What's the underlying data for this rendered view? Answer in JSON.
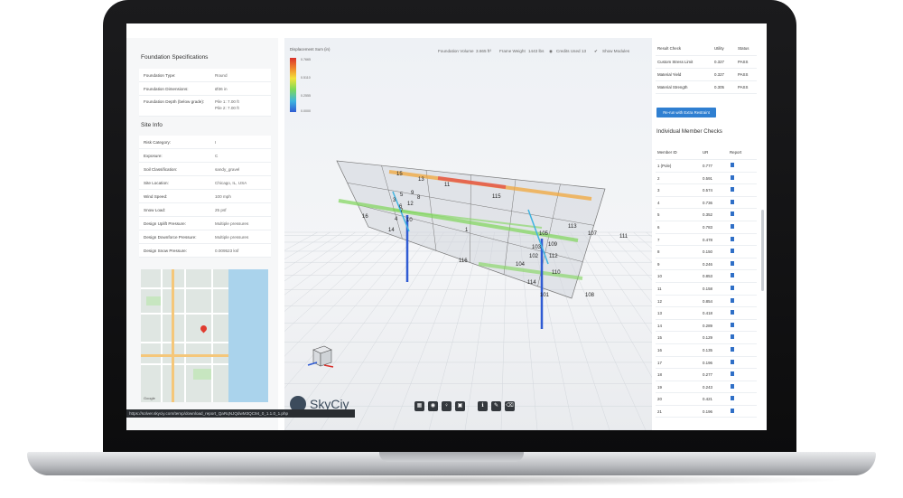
{
  "left_panel": {
    "foundation_title": "Foundation Specifications",
    "foundation": [
      {
        "k": "Foundation Type:",
        "v": "Round"
      },
      {
        "k": "Foundation Dimensions:",
        "v": "Ø36 in"
      },
      {
        "k": "Foundation Depth (below grade):",
        "v": "Pile 1: 7.00 ft",
        "v2": "Pile 2: 7.00 ft"
      }
    ],
    "site_title": "Site Info",
    "site": [
      {
        "k": "Risk Category:",
        "v": "I"
      },
      {
        "k": "Exposure:",
        "v": "C"
      },
      {
        "k": "Soil Classification:",
        "v": "sandy_gravel"
      },
      {
        "k": "Site Location:",
        "v": "Chicago, IL, USA"
      },
      {
        "k": "Wind Speed:",
        "v": "100 mph"
      },
      {
        "k": "Snow Load:",
        "v": "25 psf"
      },
      {
        "k": "Design Uplift Pressure:",
        "v": "Multiple pressures"
      },
      {
        "k": "Design Downforce Pressure:",
        "v": "Multiple pressures"
      },
      {
        "k": "Design Snow Pressure:",
        "v": "0.009523 ksf"
      }
    ],
    "map_credit": "Google"
  },
  "status_url": "https://solver.skyciy.com/temp/download_report_QaRqNJQdwM3QC94_0_1.1.0_1.php",
  "viewport": {
    "legend_title": "Displacement Sum (in)",
    "legend_values": [
      "0.7665",
      "0.5110",
      "0.2555",
      "0.0000"
    ],
    "foundation_volume_label": "Foundation Volume",
    "foundation_volume": "3.665 ft³",
    "frame_weight_label": "Frame Weight",
    "frame_weight": "1443 lbs",
    "credits_label": "Credits Used",
    "credits": "13",
    "show_modules": "Show Modules",
    "brand": "SkyCiy",
    "member_labels": [
      "15",
      "13",
      "11",
      "5",
      "9",
      "8",
      "3",
      "12",
      "6",
      "7",
      "4",
      "10",
      "16",
      "14",
      "1",
      "115",
      "116",
      "105",
      "113",
      "107",
      "111",
      "103",
      "109",
      "102",
      "112",
      "104",
      "110",
      "114",
      "101",
      "108"
    ]
  },
  "right_panel": {
    "result_headers": [
      "Result Check",
      "Utility",
      "Status"
    ],
    "results": [
      {
        "check": "Custom Stress Limit",
        "utility": "0.327",
        "status": "PASS"
      },
      {
        "check": "Material Yield",
        "utility": "0.327",
        "status": "PASS"
      },
      {
        "check": "Material Strength",
        "utility": "0.305",
        "status": "PASS"
      }
    ],
    "rerun_label": "Re-run with Extra Restraint",
    "member_checks_title": "Individual Member Checks",
    "member_headers": [
      "Member ID",
      "UR",
      "Report"
    ],
    "members": [
      {
        "id": "1 (Pole)",
        "ur": "0.777"
      },
      {
        "id": "2",
        "ur": "0.591"
      },
      {
        "id": "3",
        "ur": "0.574"
      },
      {
        "id": "4",
        "ur": "0.736"
      },
      {
        "id": "5",
        "ur": "0.352"
      },
      {
        "id": "6",
        "ur": "0.783"
      },
      {
        "id": "7",
        "ur": "0.478"
      },
      {
        "id": "8",
        "ur": "0.150"
      },
      {
        "id": "9",
        "ur": "0.246"
      },
      {
        "id": "10",
        "ur": "0.853"
      },
      {
        "id": "11",
        "ur": "0.158"
      },
      {
        "id": "12",
        "ur": "0.854"
      },
      {
        "id": "13",
        "ur": "0.418"
      },
      {
        "id": "14",
        "ur": "0.289"
      },
      {
        "id": "15",
        "ur": "0.129"
      },
      {
        "id": "16",
        "ur": "0.135"
      },
      {
        "id": "17",
        "ur": "0.196"
      },
      {
        "id": "18",
        "ur": "0.277"
      },
      {
        "id": "19",
        "ur": "0.243"
      },
      {
        "id": "20",
        "ur": "0.421"
      },
      {
        "id": "21",
        "ur": "0.196"
      }
    ]
  },
  "colors": {
    "accent": "#2f7fd1",
    "laptop": "#111213",
    "panel_bg": "#f6f7f8"
  }
}
